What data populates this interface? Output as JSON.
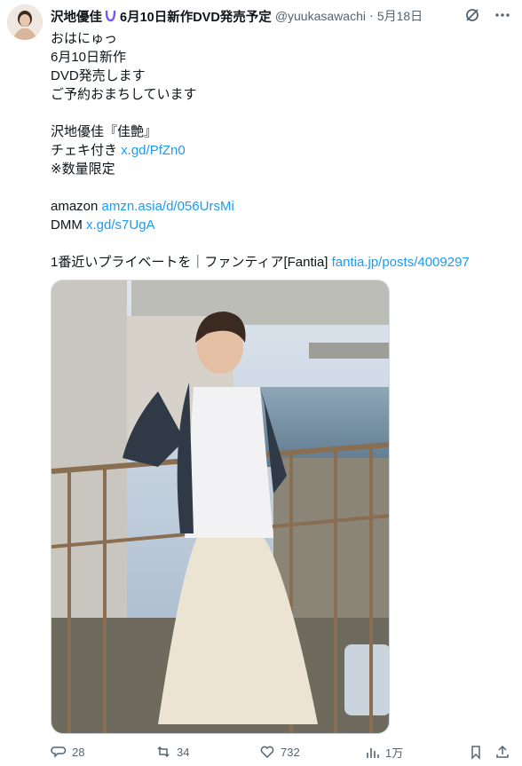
{
  "tweet": {
    "author_name": "沢地優佳",
    "headline": "6月10日新作DVD発売予定",
    "handle": "@yuukasawachi",
    "separator": "·",
    "date": "5月18日",
    "lines": [
      {
        "text": "おはにゅっ",
        "link": ""
      },
      {
        "text": "6月10日新作",
        "link": ""
      },
      {
        "text": "DVD発売します",
        "link": ""
      },
      {
        "text": "ご予約おまちしています",
        "link": ""
      },
      {
        "text": "",
        "link": ""
      },
      {
        "text": "沢地優佳『佳艶』",
        "link": ""
      },
      {
        "text": "チェキ付き ",
        "link": "x.gd/PfZn0"
      },
      {
        "text": "※数量限定",
        "link": ""
      },
      {
        "text": "",
        "link": ""
      },
      {
        "text": "amazon ",
        "link": "amzn.asia/d/056UrsMi"
      },
      {
        "text": "DMM ",
        "link": "x.gd/s7UgA"
      },
      {
        "text": "",
        "link": ""
      },
      {
        "text": "1番近いプライベートを｜ファンティア[Fantia] ",
        "link": "fantia.jp/posts/4009297"
      }
    ]
  },
  "actions": {
    "replies": "28",
    "retweets": "34",
    "likes": "732",
    "views": "1万"
  },
  "icons": {
    "header_badge": "purple-horseshoe-icon",
    "grok": "grok-icon",
    "more": "more-icon",
    "reply": "reply-icon",
    "retweet": "retweet-icon",
    "like": "heart-icon",
    "views": "views-icon",
    "bookmark": "bookmark-icon",
    "share": "share-icon"
  },
  "colors": {
    "link": "#1d9bf0",
    "muted": "#536471",
    "badge": "#7856ff"
  }
}
